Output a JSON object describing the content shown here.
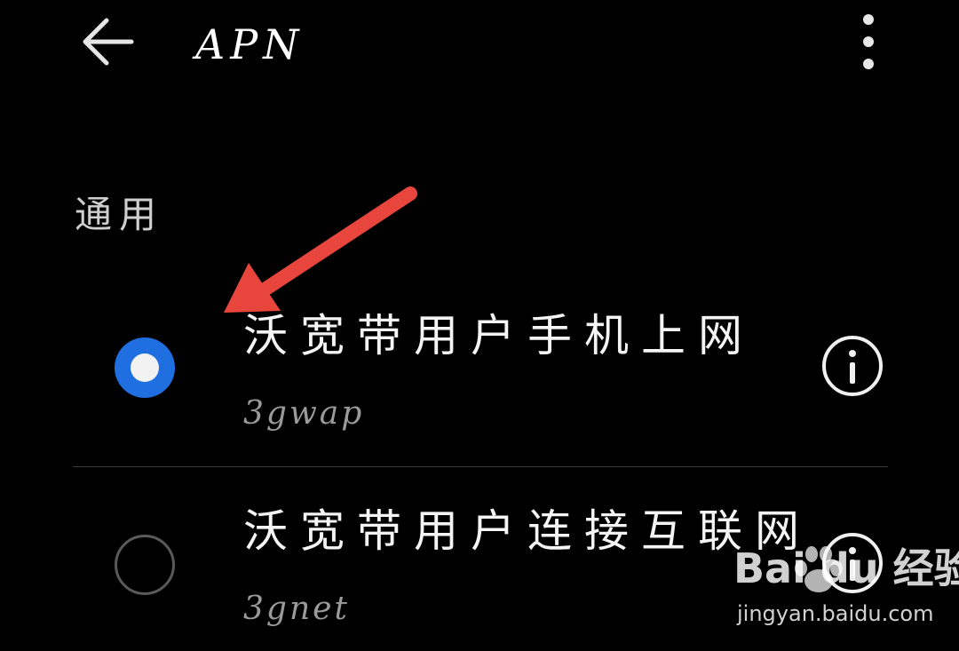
{
  "header": {
    "back_icon": "arrow-left-icon",
    "title": "APN",
    "more_icon": "more-vertical-icon"
  },
  "section": {
    "title": "通用"
  },
  "apn_list": [
    {
      "name": "沃宽带用户手机上网",
      "apn": "3gwap",
      "selected": true,
      "info_icon": "info-icon"
    },
    {
      "name": "沃宽带用户连接互联网",
      "apn": "3gnet",
      "selected": false,
      "info_icon": "info-icon"
    }
  ],
  "colors": {
    "background": "#000000",
    "radio_selected": "#1f6fe0",
    "annotation_arrow": "#e8453c",
    "secondary_text": "#9a9a9a"
  },
  "annotation": {
    "type": "arrow",
    "icon": "red-arrow-icon"
  },
  "watermark": {
    "logo_text": "Bai du 经验",
    "url": "jingyan.baidu.com"
  }
}
